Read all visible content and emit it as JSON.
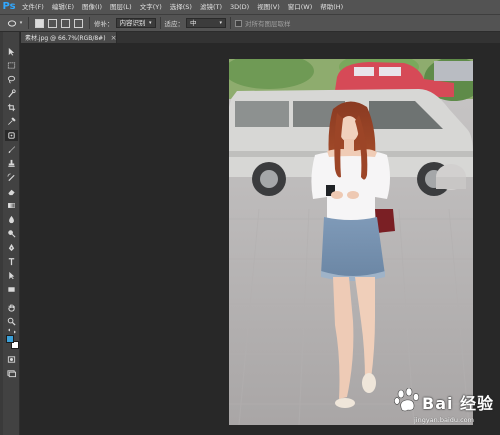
{
  "app": {
    "logo": "Ps"
  },
  "menu": {
    "items": [
      "文件(F)",
      "编辑(E)",
      "图像(I)",
      "图层(L)",
      "文字(Y)",
      "选择(S)",
      "滤镜(T)",
      "3D(D)",
      "视图(V)",
      "窗口(W)",
      "帮助(H)"
    ]
  },
  "options": {
    "patch_label": "修补：",
    "patch_mode": "内容识别",
    "adapt_label": "适应：",
    "adapt_value": "中",
    "sample_all_label": "对所有图层取样"
  },
  "document": {
    "tab_title": "素材.jpg @ 66.7%(RGB/8#)",
    "close_glyph": "×"
  },
  "watermark": {
    "brand": "Bai 经验",
    "url": "jingyan.baidu.com"
  },
  "colors": {
    "foreground": "#3aa0d8",
    "background": "#ffffff",
    "ui_dark": "#282828",
    "ui_panel": "#535353"
  }
}
